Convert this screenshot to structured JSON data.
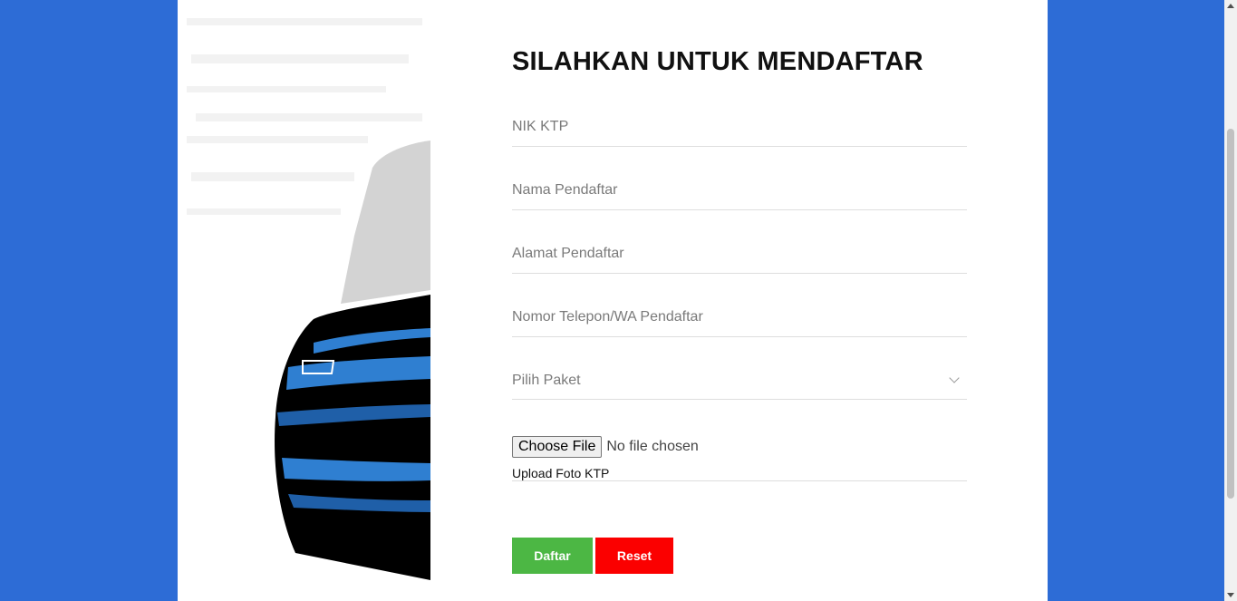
{
  "form": {
    "title": "SILAHKAN UNTUK MENDAFTAR",
    "fields": {
      "nik_placeholder": "NIK KTP",
      "nama_placeholder": "Nama Pendaftar",
      "alamat_placeholder": "Alamat Pendaftar",
      "telepon_placeholder": "Nomor Telepon/WA Pendaftar",
      "paket_selected": "Pilih Paket"
    },
    "upload": {
      "button_label": "Choose File",
      "status": "No file chosen",
      "label": "Upload Foto KTP"
    },
    "buttons": {
      "daftar": "Daftar",
      "reset": "Reset"
    }
  },
  "colors": {
    "background": "#2d6cd6",
    "daftar_button": "#4cb744",
    "reset_button": "#fb0000"
  },
  "icons": {
    "select_chevron": "chevron-down-icon"
  }
}
